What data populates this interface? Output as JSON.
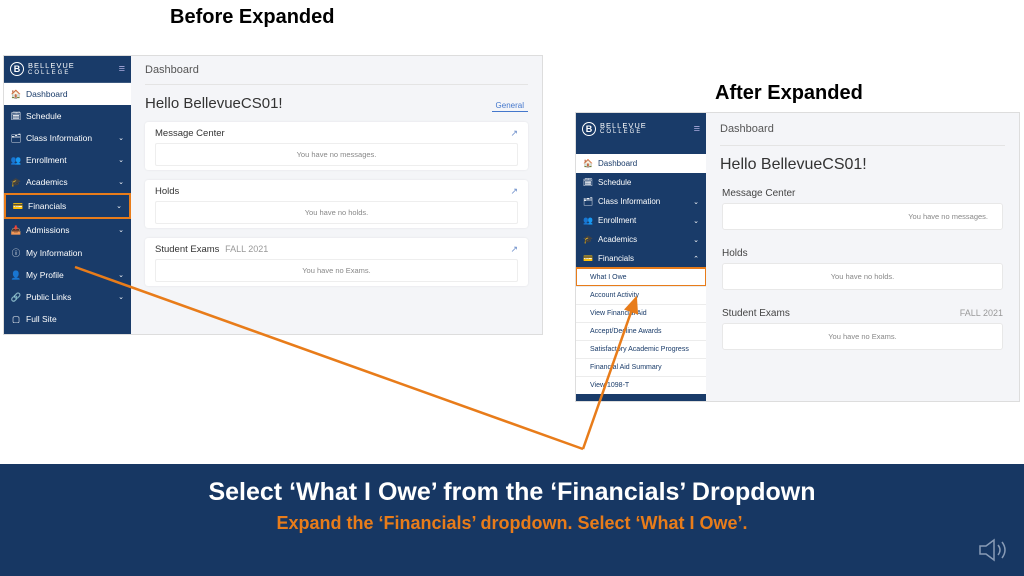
{
  "titles": {
    "before": "Before Expanded",
    "after": "After Expanded"
  },
  "logo": {
    "letter": "B",
    "line1": "BELLEVUE",
    "line2": "COLLEGE"
  },
  "page_title": "Dashboard",
  "hello": "Hello BellevueCS01!",
  "general_tab": "General",
  "nav": {
    "dashboard": "Dashboard",
    "schedule": "Schedule",
    "class_info": "Class Information",
    "enrollment": "Enrollment",
    "academics": "Academics",
    "financials": "Financials",
    "admissions": "Admissions",
    "my_info": "My Information",
    "my_profile": "My Profile",
    "public_links": "Public Links",
    "full_site": "Full Site"
  },
  "financials_sub": {
    "what_i_owe": "What I Owe",
    "account_activity": "Account Activity",
    "view_fin_aid": "View Financial Aid",
    "accept_decline": "Accept/Decline Awards",
    "sap": "Satisfactory Academic Progress",
    "fa_summary": "Financial Aid Summary",
    "view_1098t": "View 1098-T"
  },
  "cards": {
    "msg_title": "Message Center",
    "msg_body": "You have no messages.",
    "holds_title": "Holds",
    "holds_body": "You have no holds.",
    "exams_title": "Student Exams",
    "exams_term": "FALL 2021",
    "exams_body": "You have no Exams."
  },
  "glyph": {
    "ext": "↗"
  },
  "banner": {
    "line1": "Select ‘What I Owe’ from the ‘Financials’ Dropdown",
    "line2": "Expand the ‘Financials’ dropdown. Select ‘What I Owe’."
  }
}
